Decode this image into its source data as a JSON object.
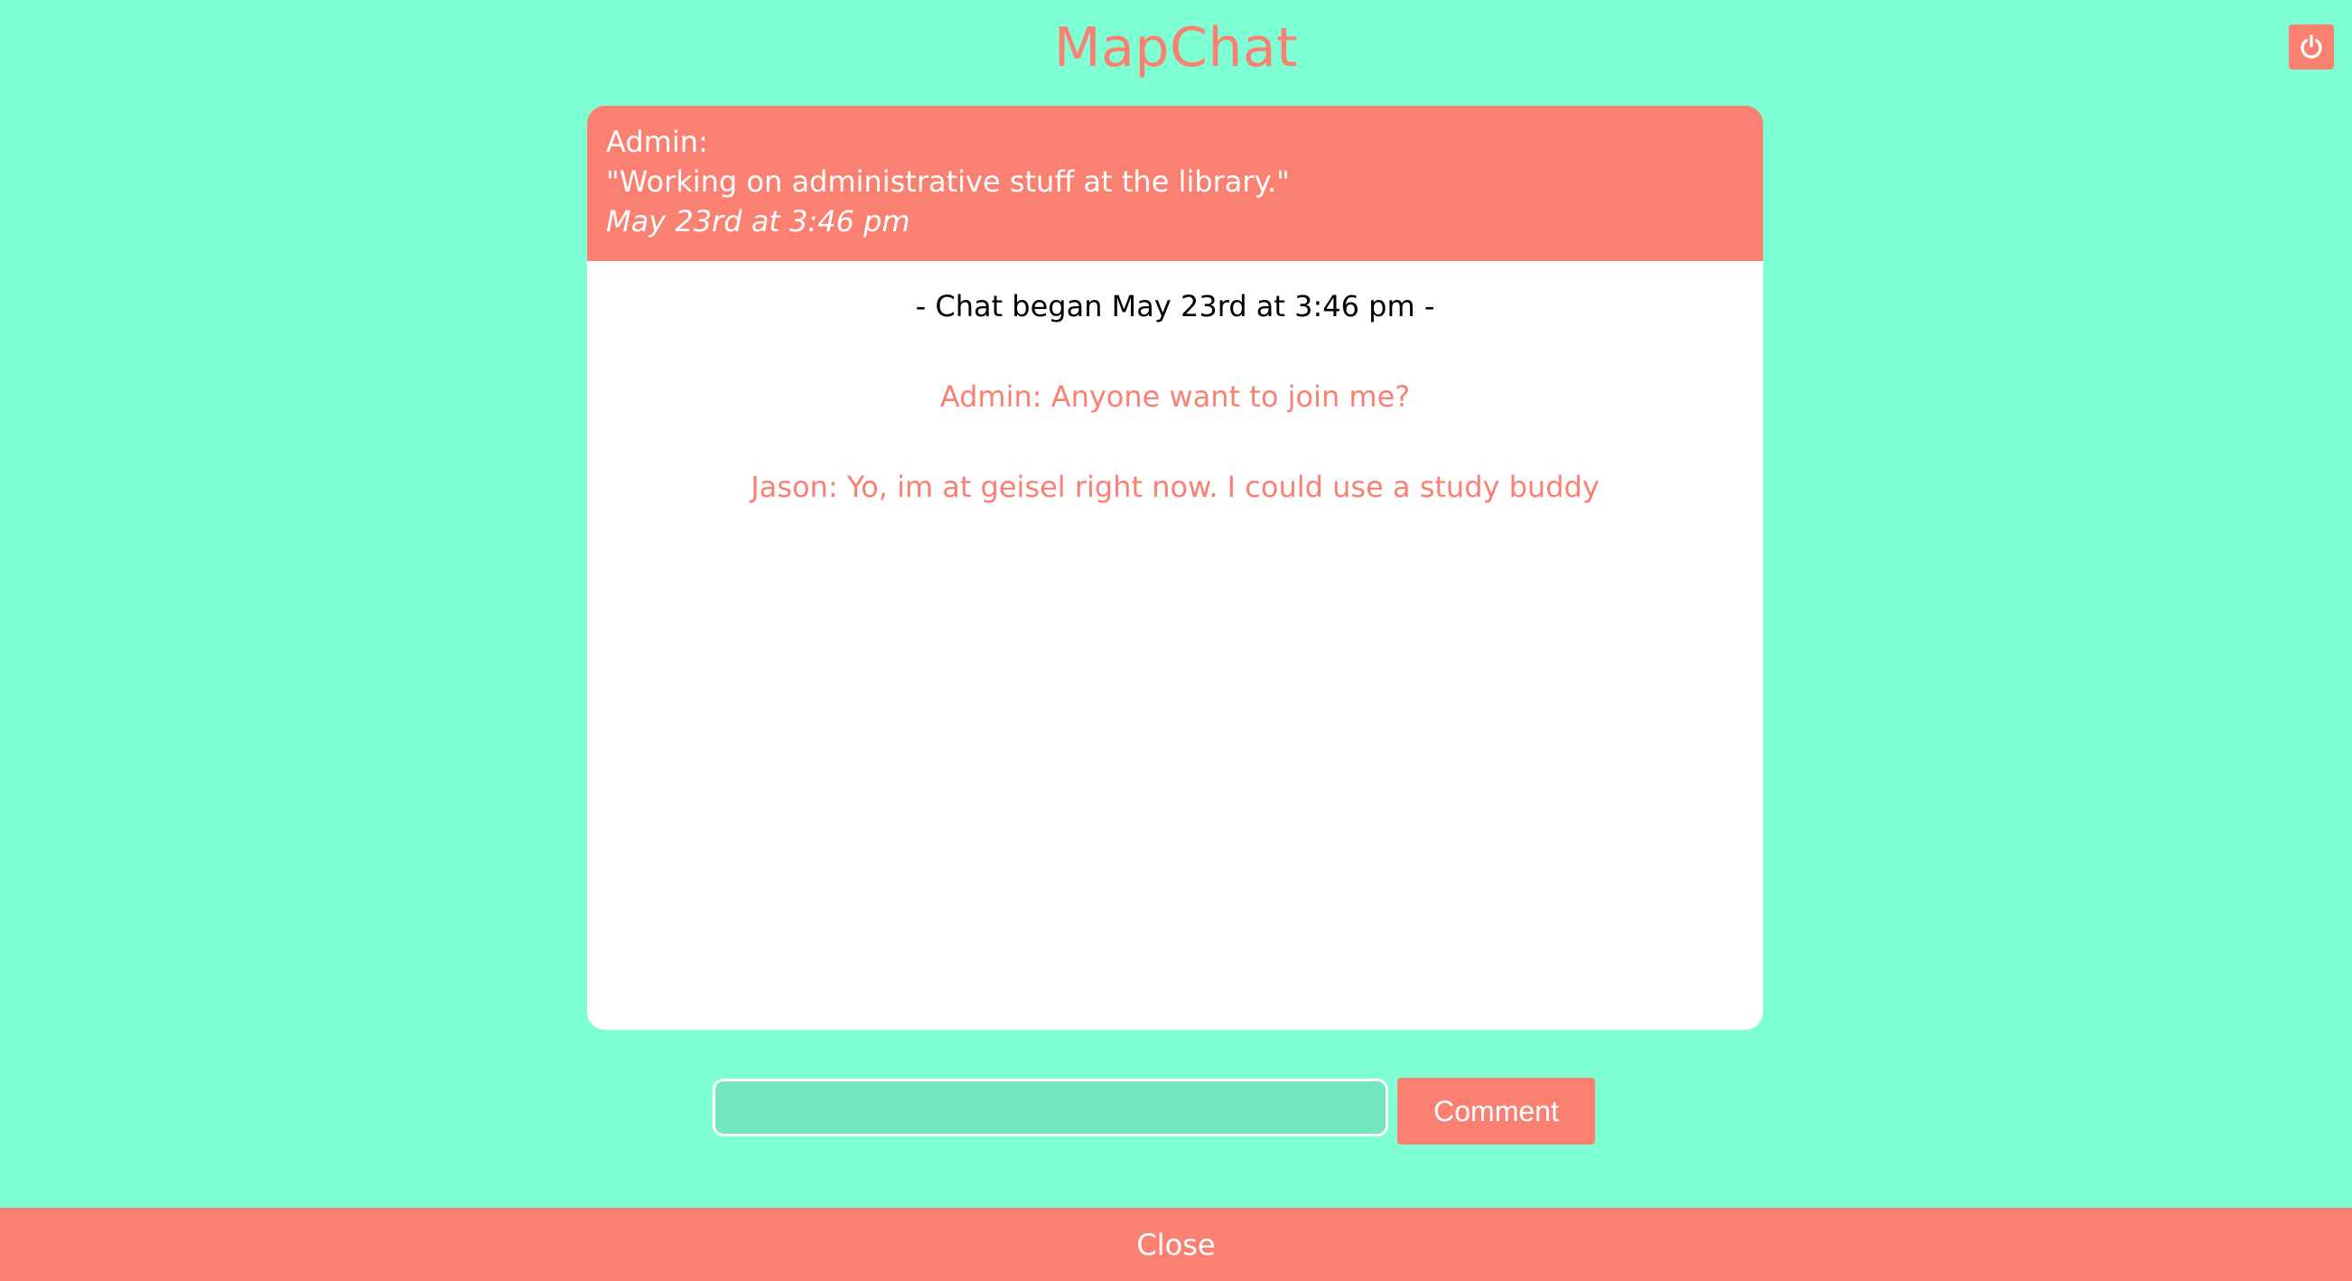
{
  "app": {
    "title": "MapChat"
  },
  "header": {
    "power_icon": "power-icon"
  },
  "post": {
    "author": "Admin:",
    "message": "\"Working on administrative stuff at the library.\"",
    "time": "May 23rd at 3:46 pm"
  },
  "chat": {
    "began": "- Chat began May 23rd at 3:46 pm -",
    "messages": [
      {
        "text": "Admin: Anyone want to join me?"
      },
      {
        "text": "Jason: Yo, im at geisel right now. I could use a study buddy"
      }
    ]
  },
  "composer": {
    "value": "",
    "placeholder": "",
    "comment_label": "Comment"
  },
  "footer": {
    "close_label": "Close"
  },
  "colors": {
    "background": "#7fffd4",
    "accent": "#fa8072",
    "input_bg": "#73e6be"
  }
}
